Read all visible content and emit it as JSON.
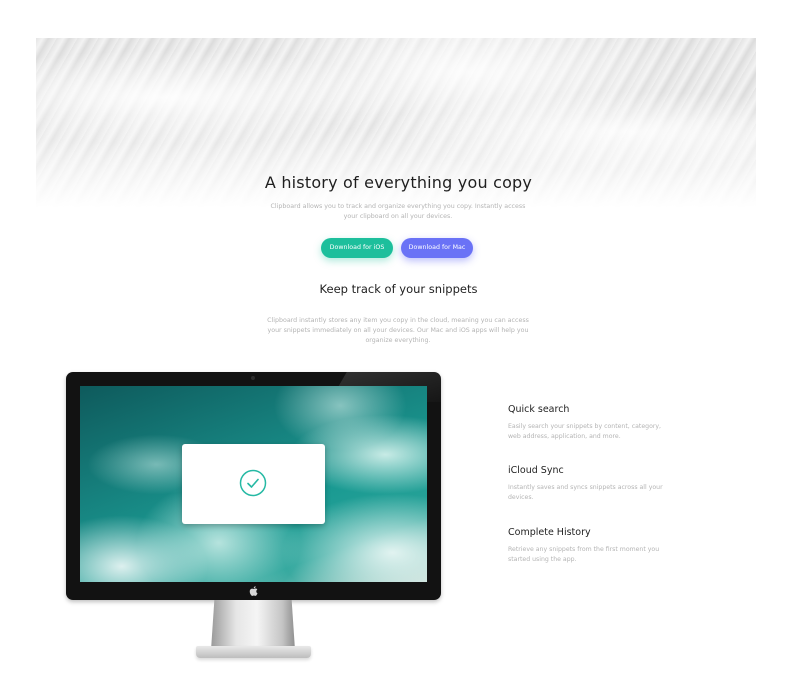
{
  "hero": {
    "title": "A history of everything you copy",
    "subtitle": "Clipboard allows you to track and organize everything you copy. Instantly access your clipboard on all your devices.",
    "buttons": {
      "ios_label": "Download for iOS",
      "mac_label": "Download for Mac"
    }
  },
  "snippets": {
    "title": "Keep track of your snippets",
    "description": "Clipboard instantly stores any item you copy in the cloud, meaning you can access your snippets immediately on all your devices. Our Mac and iOS apps will help you organize everything."
  },
  "features": [
    {
      "title": "Quick search",
      "description": "Easily search your snippets by content, category, web address, application, and more."
    },
    {
      "title": "iCloud Sync",
      "description": "Instantly saves and syncs snippets across all your devices."
    },
    {
      "title": "Complete History",
      "description": "Retrieve any snippets from the first moment you started using the app."
    }
  ],
  "colors": {
    "ios_button": "#1dbf9c",
    "mac_button": "#6a72f6",
    "check_accent": "#26b9a4"
  },
  "icons": {
    "check": "check-circle-icon",
    "apple": "apple-logo-icon"
  }
}
